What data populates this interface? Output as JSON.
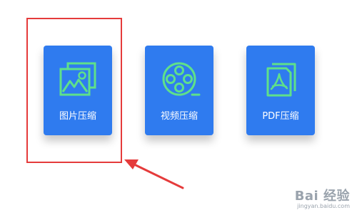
{
  "cards": [
    {
      "label": "图片压缩",
      "icon": "image-icon"
    },
    {
      "label": "视频压缩",
      "icon": "film-reel-icon"
    },
    {
      "label": "PDF压缩",
      "icon": "pdf-icon"
    }
  ],
  "colors": {
    "card_bg": "#2f7bef",
    "icon_green": "#5fe08a",
    "highlight_red": "#e53b3b"
  },
  "watermark": {
    "brand": "Bai 经验",
    "domain": "jingyan.baidu.com"
  }
}
